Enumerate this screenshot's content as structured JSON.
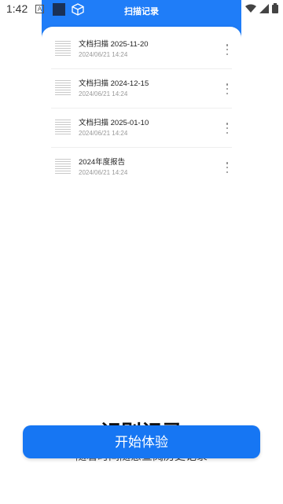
{
  "status_bar": {
    "time": "1:42",
    "icons": [
      "notification-a-icon",
      "wifi-icon",
      "signal-icon",
      "battery-icon"
    ]
  },
  "phone": {
    "header": {
      "title": "扫描记录",
      "bg_color": "#1f7df8",
      "icons": [
        "dark-square-icon",
        "cube-icon"
      ]
    },
    "records": [
      {
        "title": "文档扫描 2025-11-20",
        "date": "2024/06/21   14:24"
      },
      {
        "title": "文档扫描 2024-12-15",
        "date": "2024/06/21   14:24"
      },
      {
        "title": "文档扫描 2025-01-10",
        "date": "2024/06/21   14:24"
      },
      {
        "title": "2024年度报告",
        "date": "2024/06/21   14:24"
      }
    ]
  },
  "background": {
    "heading": "识别记录",
    "subtitle": "随着时间随意查阅历史记录"
  },
  "cta": {
    "label": "开始体验",
    "color": "#1676f3"
  }
}
